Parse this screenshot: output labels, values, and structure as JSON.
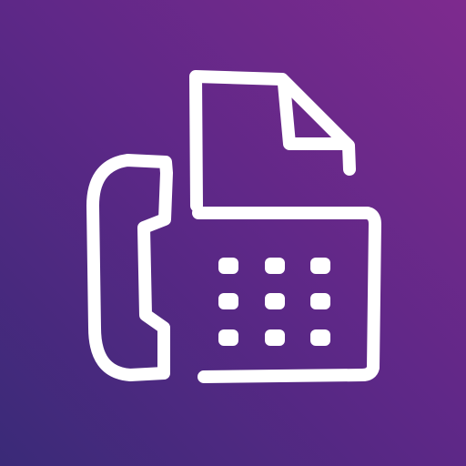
{
  "icon": {
    "name": "fax-machine-icon",
    "colors": {
      "gradient_start": "#3a2a78",
      "gradient_mid": "#5d2887",
      "gradient_end": "#7e2a8e",
      "stroke": "#ffffff"
    }
  }
}
